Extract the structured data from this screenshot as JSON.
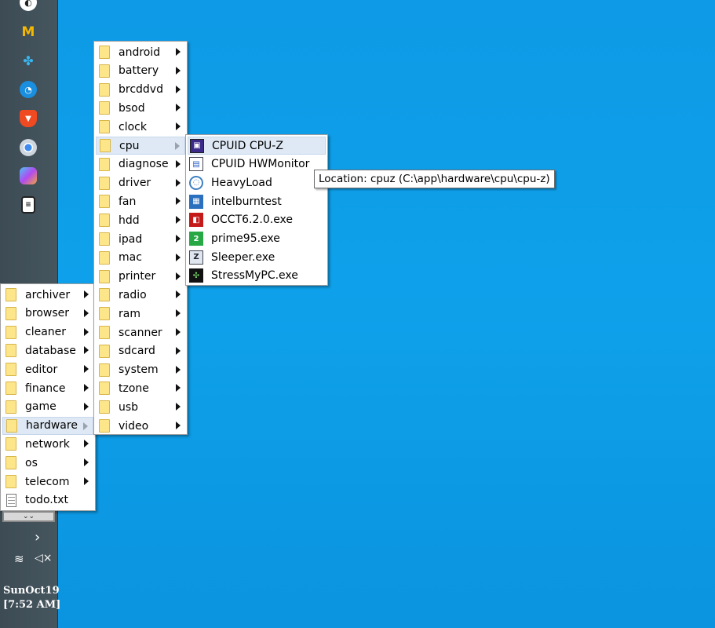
{
  "taskbar": {
    "icons": [
      "incognito-icon",
      "gmail-icon",
      "kali-dragon-icon",
      "speedometer-icon",
      "brave-browser-icon",
      "chrome-icon",
      "microsoft-365-icon",
      "notepad-app-icon"
    ],
    "clock_day": "SunOct19",
    "clock_time": "[7:52 AM]"
  },
  "root_menu": {
    "items": [
      {
        "label": "archiver",
        "submenu": true
      },
      {
        "label": "browser",
        "submenu": true
      },
      {
        "label": "cleaner",
        "submenu": true
      },
      {
        "label": "database",
        "submenu": true
      },
      {
        "label": "editor",
        "submenu": true
      },
      {
        "label": "finance",
        "submenu": true
      },
      {
        "label": "game",
        "submenu": true
      },
      {
        "label": "hardware",
        "submenu": true,
        "highlighted": true
      },
      {
        "label": "network",
        "submenu": true
      },
      {
        "label": "os",
        "submenu": true
      },
      {
        "label": "telecom",
        "submenu": true
      },
      {
        "label": "todo.txt",
        "submenu": false,
        "file": true
      }
    ]
  },
  "hardware_menu": {
    "items": [
      {
        "label": "android"
      },
      {
        "label": "battery"
      },
      {
        "label": "brcddvd"
      },
      {
        "label": "bsod"
      },
      {
        "label": "clock"
      },
      {
        "label": "cpu",
        "highlighted": true
      },
      {
        "label": "diagnose"
      },
      {
        "label": "driver"
      },
      {
        "label": "fan"
      },
      {
        "label": "hdd"
      },
      {
        "label": "ipad"
      },
      {
        "label": "mac"
      },
      {
        "label": "printer"
      },
      {
        "label": "radio"
      },
      {
        "label": "ram"
      },
      {
        "label": "scanner"
      },
      {
        "label": "sdcard"
      },
      {
        "label": "system"
      },
      {
        "label": "tzone"
      },
      {
        "label": "usb"
      },
      {
        "label": "video"
      }
    ]
  },
  "cpu_menu": {
    "items": [
      {
        "label": "CPUID CPU-Z",
        "icon": "cpu-z-icon",
        "highlighted": true
      },
      {
        "label": "CPUID HWMonitor",
        "icon": "hwmonitor-icon"
      },
      {
        "label": "HeavyLoad",
        "icon": "heavyload-icon"
      },
      {
        "label": "intelburntest",
        "icon": "intelburntest-icon"
      },
      {
        "label": "OCCT6.2.0.exe",
        "icon": "occt-icon"
      },
      {
        "label": "prime95.exe",
        "icon": "prime95-icon"
      },
      {
        "label": "Sleeper.exe",
        "icon": "sleeper-icon"
      },
      {
        "label": "StressMyPC.exe",
        "icon": "stressmypc-icon"
      }
    ]
  },
  "tooltip": {
    "text": "Location: cpuz (C:\\app\\hardware\\cpu\\cpu-z)"
  },
  "more_button": {
    "label": "⌄⌄"
  },
  "tray": {
    "expand": "›",
    "wifi": "wifi-icon",
    "volume": "volume-muted-icon"
  }
}
